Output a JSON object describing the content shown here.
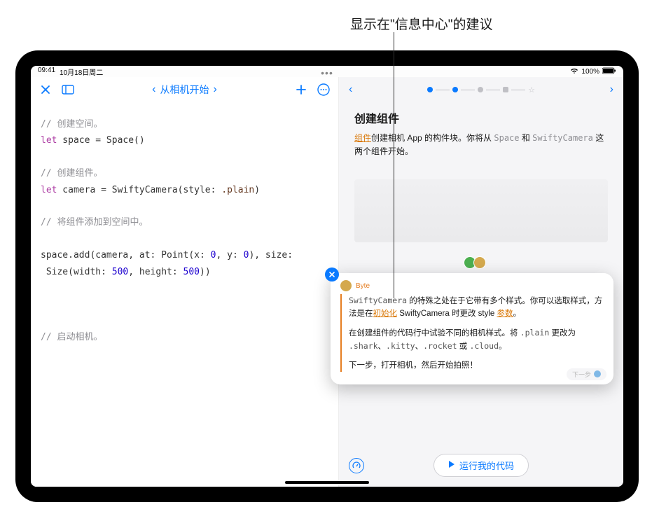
{
  "annotation": "显示在\"信息中心\"的建议",
  "status": {
    "time": "09:41",
    "date": "10月18日周二",
    "battery": "100%"
  },
  "toolbar": {
    "title": "从相机开始"
  },
  "code": {
    "c1": "// 创建空间。",
    "l1a": "let",
    "l1b": " space = Space()",
    "c2": "// 创建组件。",
    "l2a": "let",
    "l2b": " camera = SwiftyCamera(style: ",
    "l2c": ".plain",
    "l2d": ")",
    "c3": "// 将组件添加到空间中。",
    "l3a": "space.add(camera, at: Point(x: ",
    "l3b": "0",
    "l3c": ", y: ",
    "l3d": "0",
    "l3e": "), size:",
    "l4a": " Size(width: ",
    "l4b": "500",
    "l4c": ", height: ",
    "l4d": "500",
    "l4e": "))",
    "c4": "// 启动相机。"
  },
  "guide": {
    "title": "创建组件",
    "link": "组件",
    "text1": "创建相机 App 的构件块。你将从 ",
    "code1": "Space",
    "text2": " 和 ",
    "code2": "SwiftyCamera",
    "text3": " 这两个组件开始。",
    "info_center": "信息中心"
  },
  "hint": {
    "name": "Byte",
    "p1a": "SwiftyCamera",
    "p1b": " 的特殊之处在于它带有多个样式。你可以选取样式，方法是在",
    "p1link1": "初始化",
    "p1c": " SwiftyCamera 时更改 style ",
    "p1link2": "参数",
    "p1d": "。",
    "p2a": "在创建组件的代码行中试验不同的相机样式。将 ",
    "p2code1": ".plain",
    "p2b": " 更改为 ",
    "p2code2": ".shark",
    "p2c": "、",
    "p2code3": ".kitty",
    "p2d": "、",
    "p2code4": ".rocket",
    "p2e": " 或 ",
    "p2code5": ".cloud",
    "p2f": "。",
    "p3": "下一步，打开相机，然后开始拍照！",
    "next": "下一步"
  },
  "run": {
    "label": "运行我的代码"
  }
}
